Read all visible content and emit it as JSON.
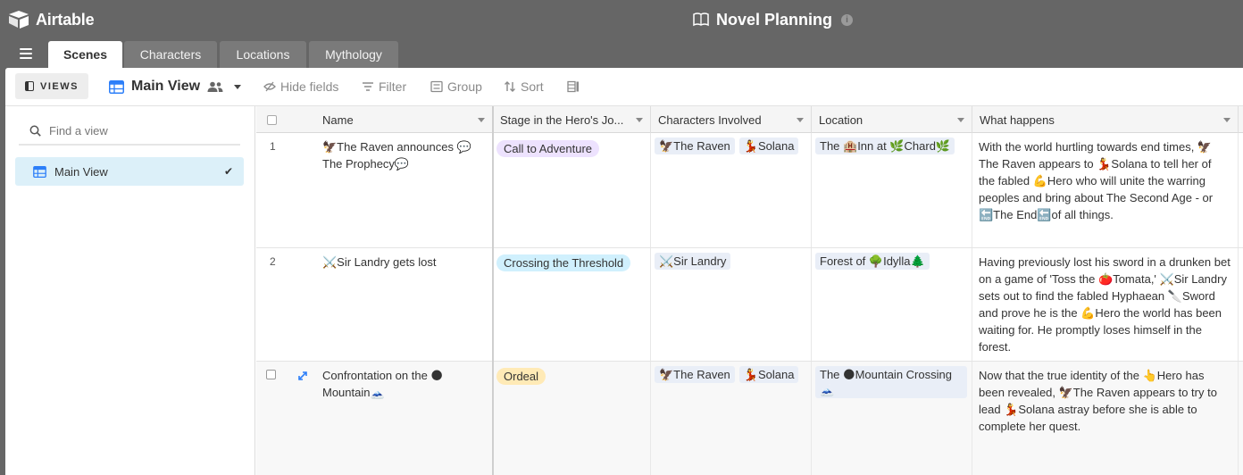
{
  "app": {
    "name": "Airtable"
  },
  "base": {
    "title": "Novel Planning"
  },
  "tabs": [
    {
      "label": "Scenes",
      "active": true
    },
    {
      "label": "Characters",
      "active": false
    },
    {
      "label": "Locations",
      "active": false
    },
    {
      "label": "Mythology",
      "active": false
    }
  ],
  "viewbar": {
    "views_label": "VIEWS",
    "current_view": "Main View",
    "tools": {
      "hide_fields": "Hide fields",
      "filter": "Filter",
      "group": "Group",
      "sort": "Sort"
    }
  },
  "sidebar": {
    "find_placeholder": "Find a view",
    "views": [
      {
        "label": "Main View",
        "selected": true
      }
    ]
  },
  "grid": {
    "columns": {
      "name": "Name",
      "stage": "Stage in the Hero's Jo...",
      "characters": "Characters Involved",
      "location": "Location",
      "what": "What happens"
    },
    "rows": [
      {
        "num": "1",
        "name": "🦅The Raven announces 💬The Prophecy💬",
        "stage": "Call to Adventure",
        "stage_color": "#ede2fe",
        "characters": [
          "🦅The Raven",
          "💃Solana"
        ],
        "location": "The 🏨Inn at 🌿Chard🌿",
        "what": "With the world hurtling towards end times, 🦅The Raven appears to 💃Solana to tell her of the fabled 💪Hero who will unite the warring peoples and bring about The Second Age - or 🔚The End🔚of all things."
      },
      {
        "num": "2",
        "name": "⚔️Sir Landry gets lost",
        "stage": "Crossing the Threshold",
        "stage_color": "#d0f0fd",
        "characters": [
          "⚔️Sir Landry"
        ],
        "location": "Forest of 🌳Idylla🌲",
        "what": "Having previously lost his sword in a drunken bet on a game of 'Toss the 🍅Tomata,' ⚔️Sir Landry sets out to find the fabled Hyphaean 🔪Sword and prove he is the 💪Hero the world has been waiting for. He promptly loses himself in the forest."
      },
      {
        "num": "",
        "name": "Confrontation on the 🌑 Mountain🗻",
        "stage": "Ordeal",
        "stage_color": "#ffeab6",
        "characters": [
          "🦅The Raven",
          "💃Solana"
        ],
        "location": "The 🌑Mountain Crossing🗻",
        "what": "Now that the true identity of the 👆Hero has been revealed, 🦅The Raven appears to try to lead 💃Solana astray before she is able to complete her quest."
      }
    ]
  },
  "colors": {
    "chrome": "#666666",
    "accent": "#2d7ff9",
    "selected_view_bg": "#dcf0f9"
  },
  "icons": {
    "logo": "airtable-logo-icon",
    "book": "book-icon",
    "info": "info-icon",
    "menu": "hamburger-icon",
    "grid": "grid-view-icon",
    "people": "shared-people-icon",
    "search": "search-icon",
    "check": "checkmark-icon",
    "expand": "expand-record-icon"
  }
}
